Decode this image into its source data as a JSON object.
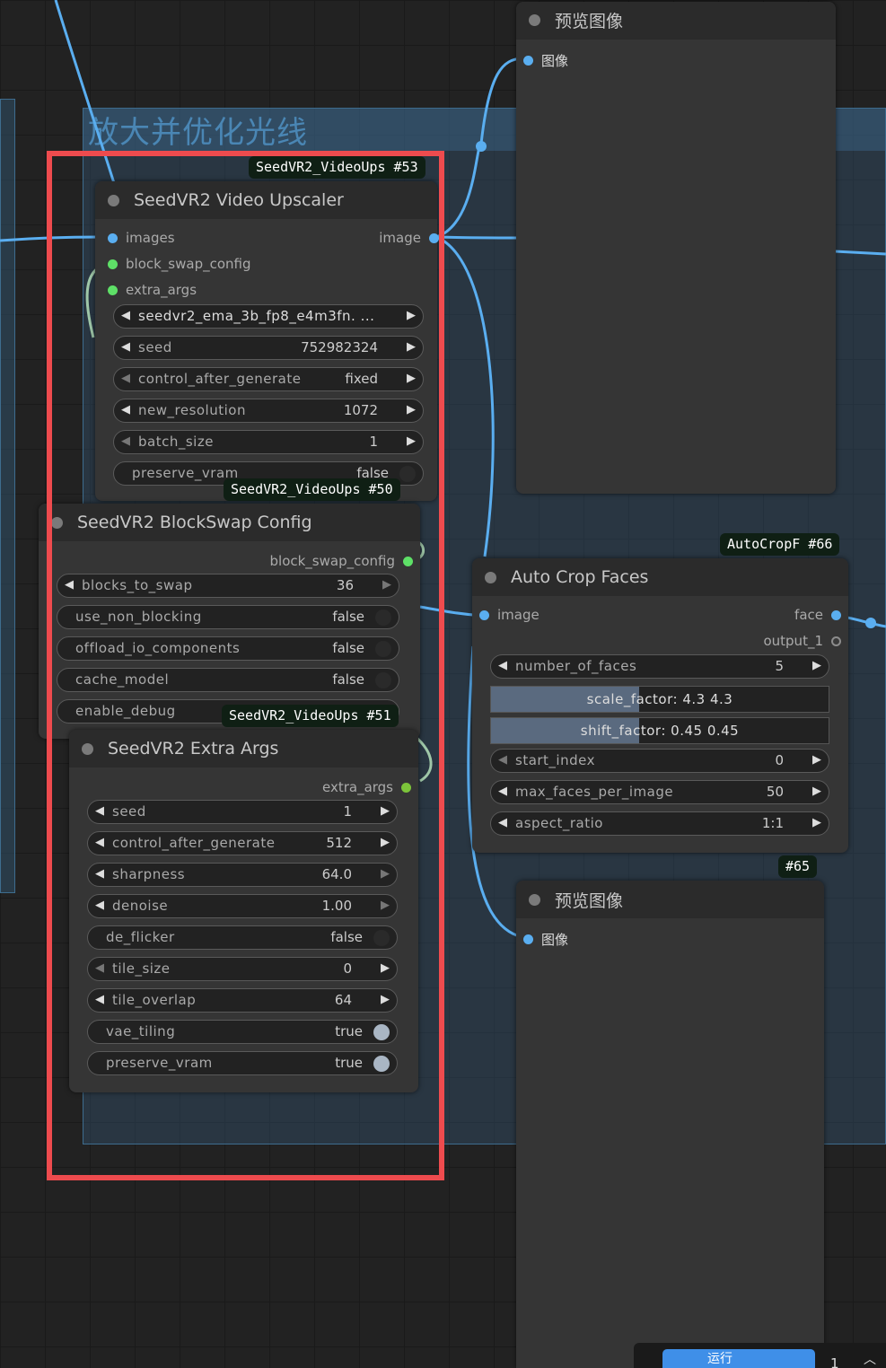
{
  "group": {
    "title": "放大并优化光线"
  },
  "preview_top": {
    "title": "预览图像",
    "input_label": "图像"
  },
  "preview_bottom": {
    "badge": "#65",
    "title": "预览图像",
    "input_label": "图像"
  },
  "upscaler": {
    "badge": "SeedVR2_VideoUps #53",
    "title": "SeedVR2 Video Upscaler",
    "inputs": [
      "images",
      "block_swap_config",
      "extra_args"
    ],
    "output": "image",
    "model": {
      "value": "seedvr2_ema_3b_fp8_e4m3fn. ..."
    },
    "seed": {
      "label": "seed",
      "value": "752982324"
    },
    "control_after_generate": {
      "label": "control_after_generate",
      "value": "fixed"
    },
    "new_resolution": {
      "label": "new_resolution",
      "value": "1072"
    },
    "batch_size": {
      "label": "batch_size",
      "value": "1"
    },
    "preserve_vram": {
      "label": "preserve_vram",
      "value": "false"
    }
  },
  "blockswap": {
    "badge": "SeedVR2_VideoUps #50",
    "title": "SeedVR2 BlockSwap Config",
    "output": "block_swap_config",
    "blocks_to_swap": {
      "label": "blocks_to_swap",
      "value": "36"
    },
    "use_non_blocking": {
      "label": "use_non_blocking",
      "value": "false"
    },
    "offload_io_components": {
      "label": "offload_io_components",
      "value": "false"
    },
    "cache_model": {
      "label": "cache_model",
      "value": "false"
    },
    "enable_debug": {
      "label": "enable_debug"
    }
  },
  "extra": {
    "badge": "SeedVR2_VideoUps #51",
    "title": "SeedVR2 Extra Args",
    "output": "extra_args",
    "seed": {
      "label": "seed",
      "value": "1"
    },
    "control_after_generate": {
      "label": "control_after_generate",
      "value": "512"
    },
    "sharpness": {
      "label": "sharpness",
      "value": "64.0"
    },
    "denoise": {
      "label": "denoise",
      "value": "1.00"
    },
    "de_flicker": {
      "label": "de_flicker",
      "value": "false"
    },
    "tile_size": {
      "label": "tile_size",
      "value": "0"
    },
    "tile_overlap": {
      "label": "tile_overlap",
      "value": "64"
    },
    "vae_tiling": {
      "label": "vae_tiling",
      "value": "true"
    },
    "preserve_vram": {
      "label": "preserve_vram",
      "value": "true"
    }
  },
  "autocrop": {
    "badge": "AutoCropF #66",
    "title": "Auto Crop Faces",
    "input": "image",
    "outputs": [
      "face",
      "output_1"
    ],
    "number_of_faces": {
      "label": "number_of_faces",
      "value": "5"
    },
    "scale_factor": {
      "text": "scale_factor: 4.3  4.3",
      "fraction": 0.44
    },
    "shift_factor": {
      "text": "shift_factor: 0.45  0.45",
      "fraction": 0.44
    },
    "start_index": {
      "label": "start_index",
      "value": "0"
    },
    "max_faces_per_image": {
      "label": "max_faces_per_image",
      "value": "50"
    },
    "aspect_ratio": {
      "label": "aspect_ratio",
      "value": "1:1"
    }
  },
  "bottom_bar": {
    "run_label": "运行",
    "count": "1"
  },
  "colors": {
    "image_wire": "#5aaef0",
    "config_wire": "#9fc7a8",
    "highlight": "#ee4b4e",
    "image_slot": "#5aaef0",
    "config_slot": "#5ee067"
  }
}
